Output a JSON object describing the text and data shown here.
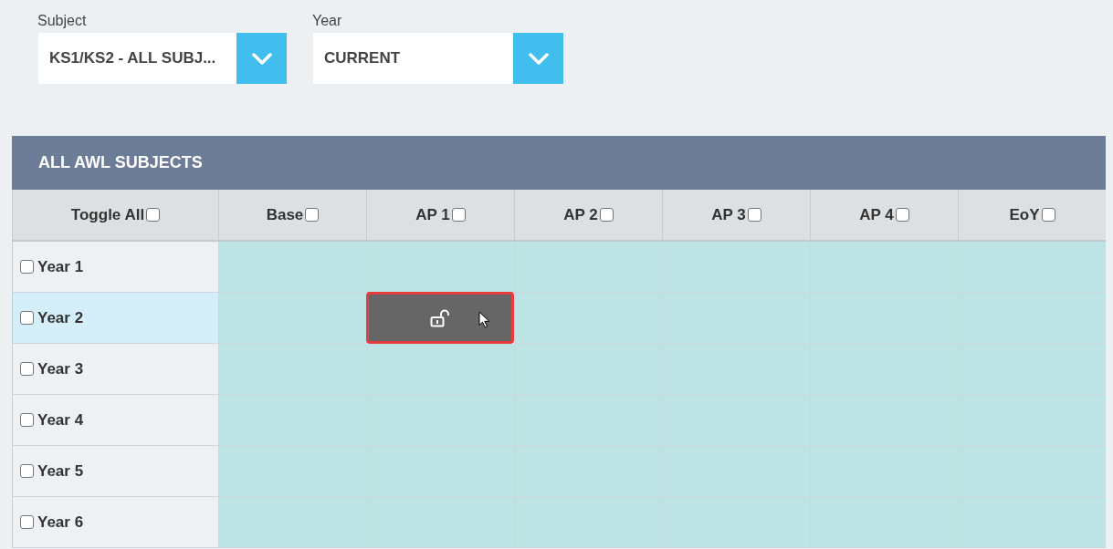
{
  "filters": [
    {
      "label": "Subject",
      "value": "KS1/KS2 - ALL SUBJ..."
    },
    {
      "label": "Year",
      "value": "CURRENT"
    }
  ],
  "table": {
    "title": "ALL AWL SUBJECTS",
    "columns": [
      {
        "label": "Toggle All",
        "checked": false
      },
      {
        "label": "Base",
        "checked": false
      },
      {
        "label": "AP 1",
        "checked": false
      },
      {
        "label": "AP 2",
        "checked": false
      },
      {
        "label": "AP 3",
        "checked": false
      },
      {
        "label": "AP 4",
        "checked": false
      },
      {
        "label": "EoY",
        "checked": false
      }
    ],
    "rows": [
      {
        "label": "Year 1",
        "checked": false,
        "highlighted": false,
        "cells": [
          {
            "kind": "blank",
            "cursor": false
          },
          {
            "kind": "blank",
            "cursor": false
          },
          {
            "kind": "blank",
            "cursor": false
          },
          {
            "kind": "blank",
            "cursor": false
          },
          {
            "kind": "blank",
            "cursor": false
          },
          {
            "kind": "blank",
            "cursor": false
          }
        ]
      },
      {
        "label": "Year 2",
        "checked": false,
        "highlighted": true,
        "cells": [
          {
            "kind": "blank",
            "cursor": false
          },
          {
            "kind": "unlocked",
            "cursor": true
          },
          {
            "kind": "blank",
            "cursor": false
          },
          {
            "kind": "blank",
            "cursor": false
          },
          {
            "kind": "blank",
            "cursor": false
          },
          {
            "kind": "blank",
            "cursor": false
          }
        ]
      },
      {
        "label": "Year 3",
        "checked": false,
        "highlighted": false,
        "cells": [
          {
            "kind": "blank",
            "cursor": false
          },
          {
            "kind": "blank",
            "cursor": false
          },
          {
            "kind": "blank",
            "cursor": false
          },
          {
            "kind": "blank",
            "cursor": false
          },
          {
            "kind": "blank",
            "cursor": false
          },
          {
            "kind": "blank",
            "cursor": false
          }
        ]
      },
      {
        "label": "Year 4",
        "checked": false,
        "highlighted": false,
        "cells": [
          {
            "kind": "blank",
            "cursor": false
          },
          {
            "kind": "blank",
            "cursor": false
          },
          {
            "kind": "blank",
            "cursor": false
          },
          {
            "kind": "blank",
            "cursor": false
          },
          {
            "kind": "blank",
            "cursor": false
          },
          {
            "kind": "blank",
            "cursor": false
          }
        ]
      },
      {
        "label": "Year 5",
        "checked": false,
        "highlighted": false,
        "cells": [
          {
            "kind": "blank",
            "cursor": false
          },
          {
            "kind": "blank",
            "cursor": false
          },
          {
            "kind": "blank",
            "cursor": false
          },
          {
            "kind": "blank",
            "cursor": false
          },
          {
            "kind": "blank",
            "cursor": false
          },
          {
            "kind": "blank",
            "cursor": false
          }
        ]
      },
      {
        "label": "Year 6",
        "checked": false,
        "highlighted": false,
        "cells": [
          {
            "kind": "blank",
            "cursor": false
          },
          {
            "kind": "blank",
            "cursor": false
          },
          {
            "kind": "blank",
            "cursor": false
          },
          {
            "kind": "blank",
            "cursor": false
          },
          {
            "kind": "blank",
            "cursor": false
          },
          {
            "kind": "blank",
            "cursor": false
          }
        ]
      }
    ]
  }
}
